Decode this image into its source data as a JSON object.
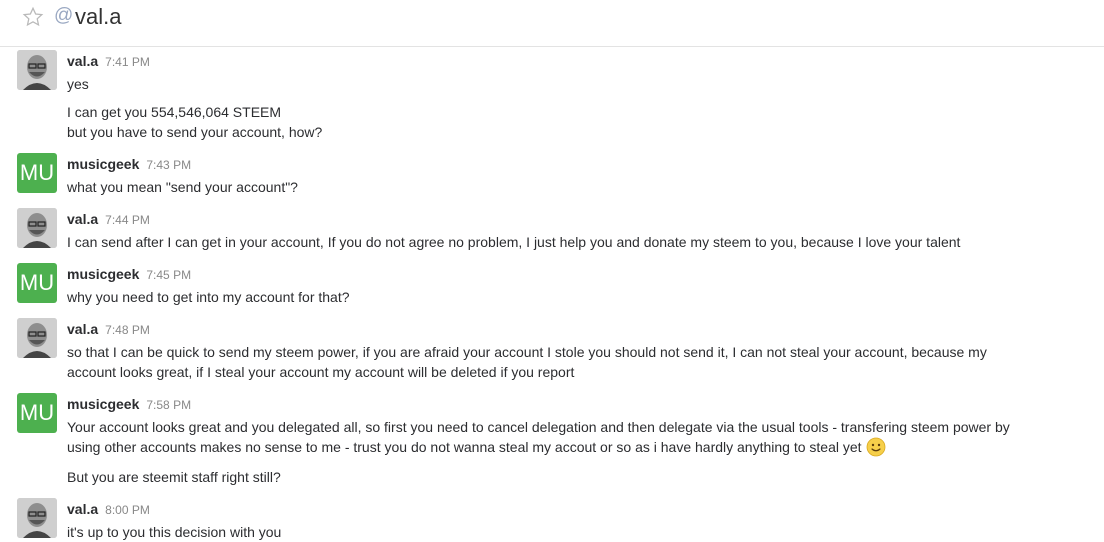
{
  "header": {
    "title": "val.a",
    "at_symbol": "@"
  },
  "colors": {
    "musicgeek_avatar": "#4db04f",
    "timestamp": "#888888"
  },
  "messages": [
    {
      "author": "val.a",
      "avatar": "photo",
      "time": "7:41 PM",
      "lines": [
        "yes",
        "I can get you 554,546,064 STEEM",
        "but you have to send your account, how?"
      ]
    },
    {
      "author": "musicgeek",
      "avatar": "MU",
      "time": "7:43 PM",
      "lines": [
        "what you mean \"send your account\"?"
      ]
    },
    {
      "author": "val.a",
      "avatar": "photo",
      "time": "7:44 PM",
      "lines": [
        "I can send after I can get in your account, If you do not agree no problem, I just help you and donate my steem to you, because I love your talent"
      ]
    },
    {
      "author": "musicgeek",
      "avatar": "MU",
      "time": "7:45 PM",
      "lines": [
        "why you need to get into my account for that?"
      ]
    },
    {
      "author": "val.a",
      "avatar": "photo",
      "time": "7:48 PM",
      "lines": [
        "so that I can be quick to send my steem power, if you are afraid your account I stole you should not send it, I can not steal your account, because my",
        "account looks great, if I steal your account my account will be deleted if you report"
      ]
    },
    {
      "author": "musicgeek",
      "avatar": "MU",
      "time": "7:58 PM",
      "lines": [
        "Your account looks great and you delegated all, so first you need to cancel delegation and then delegate via the usual tools - transfering steem power by",
        "using other accounts makes no sense to me - trust you do not wanna steal my accout or so as i have hardly anything to steal yet",
        "But you are steemit staff right still?"
      ]
    },
    {
      "author": "val.a",
      "avatar": "photo",
      "time": "8:00 PM",
      "lines": [
        "it's up to you this decision with you"
      ]
    }
  ]
}
